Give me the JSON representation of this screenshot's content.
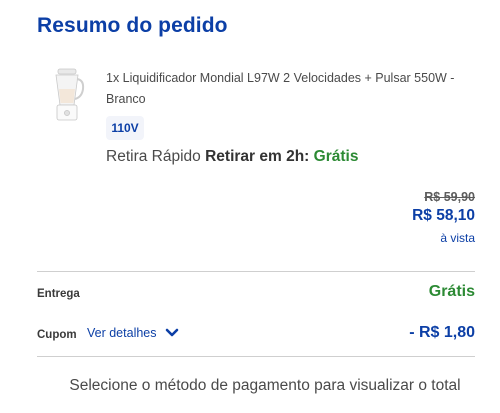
{
  "summary": {
    "title": "Resumo do pedido"
  },
  "item": {
    "image_icon": "blender-product-image",
    "name": "1x Liquidificador Mondial L97W 2 Velocidades + Pulsar 550W - Branco",
    "voltage": "110V",
    "pickup_label": "Retira Rápido",
    "pickup_time": "Retirar em 2h:",
    "pickup_price": "Grátis"
  },
  "prices": {
    "original": "R$ 59,90",
    "current": "R$ 58,10",
    "note": "à vista"
  },
  "delivery": {
    "label": "Entrega",
    "value": "Grátis"
  },
  "coupon": {
    "label": "Cupom",
    "details_link": "Ver detalhes",
    "details_icon": "chevron-down-icon",
    "value": "- R$ 1,80"
  },
  "footer": {
    "message": "Selecione o método de pagamento para visualizar o total"
  },
  "colors": {
    "brand_blue": "#0c3fa6",
    "free_green": "#2c8a34",
    "divider": "#cfcfcf"
  }
}
